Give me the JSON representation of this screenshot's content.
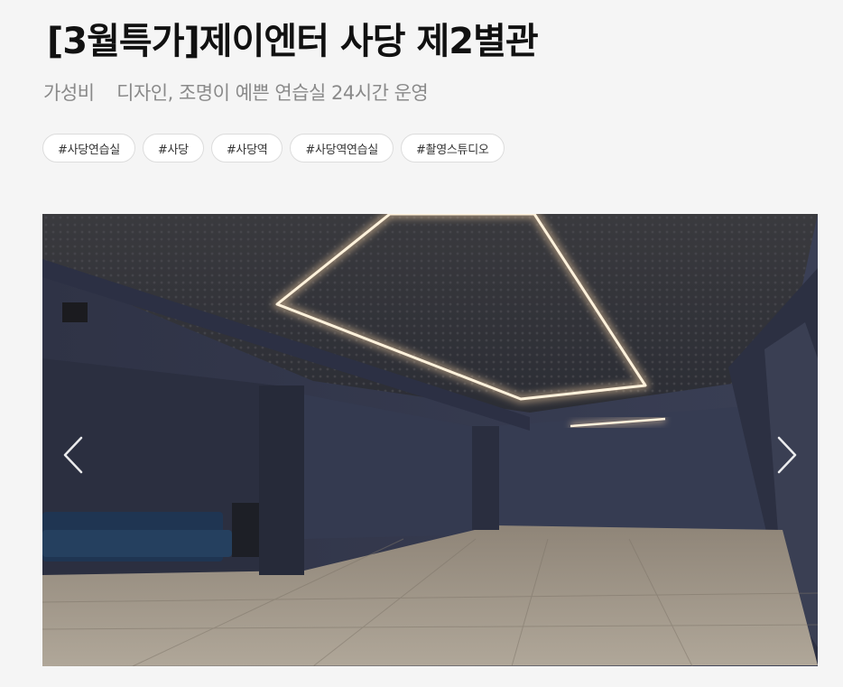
{
  "listing": {
    "title": "[3월특가]제이엔터 사당 제2별관",
    "subtitle": "가성비    디자인, 조명이 예쁜 연습실 24시간 운영"
  },
  "tags": [
    "#사당연습실",
    "#사당",
    "#사당역",
    "#사당역연습실",
    "#촬영스튜디오"
  ],
  "gallery": {
    "prev_icon": "chevron-left-icon",
    "next_icon": "chevron-right-icon"
  }
}
